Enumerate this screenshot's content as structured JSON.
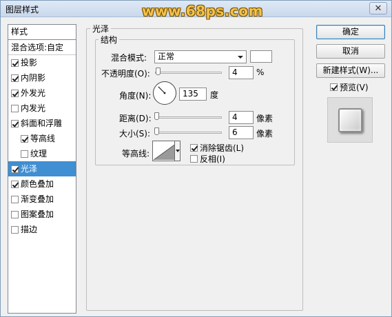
{
  "window": {
    "title": "图层样式",
    "watermark": "www.68ps.com",
    "close_glyph": "✕"
  },
  "style_list": {
    "header": "样式",
    "blend_options": "混合选项:自定",
    "items": [
      {
        "label": "投影",
        "checked": true
      },
      {
        "label": "内阴影",
        "checked": true
      },
      {
        "label": "外发光",
        "checked": true
      },
      {
        "label": "内发光",
        "checked": false
      },
      {
        "label": "斜面和浮雕",
        "checked": true
      },
      {
        "label": "等高线",
        "checked": true,
        "indent": true
      },
      {
        "label": "纹理",
        "checked": false,
        "indent": true
      },
      {
        "label": "光泽",
        "checked": true,
        "selected": true
      },
      {
        "label": "颜色叠加",
        "checked": true
      },
      {
        "label": "渐变叠加",
        "checked": false
      },
      {
        "label": "图案叠加",
        "checked": false
      },
      {
        "label": "描边",
        "checked": false
      }
    ]
  },
  "satin": {
    "group_title": "光泽",
    "structure_title": "结构",
    "blend_mode_label": "混合模式:",
    "blend_mode_value": "正常",
    "swatch_color": "#ffffff",
    "opacity_label": "不透明度(O):",
    "opacity_value": "4",
    "opacity_unit": "%",
    "angle_label": "角度(N):",
    "angle_value": "135",
    "angle_unit": "度",
    "distance_label": "距离(D):",
    "distance_value": "4",
    "distance_unit": "像素",
    "size_label": "大小(S):",
    "size_value": "6",
    "size_unit": "像素",
    "contour_label": "等高线:",
    "antialias_label": "消除锯齿(L)",
    "antialias_checked": true,
    "invert_label": "反相(I)",
    "invert_checked": false
  },
  "buttons": {
    "ok": "确定",
    "cancel": "取消",
    "new_style": "新建样式(W)...",
    "preview_label": "预览(V)",
    "preview_checked": true
  },
  "colors": {
    "selection": "#3f8fd2"
  }
}
